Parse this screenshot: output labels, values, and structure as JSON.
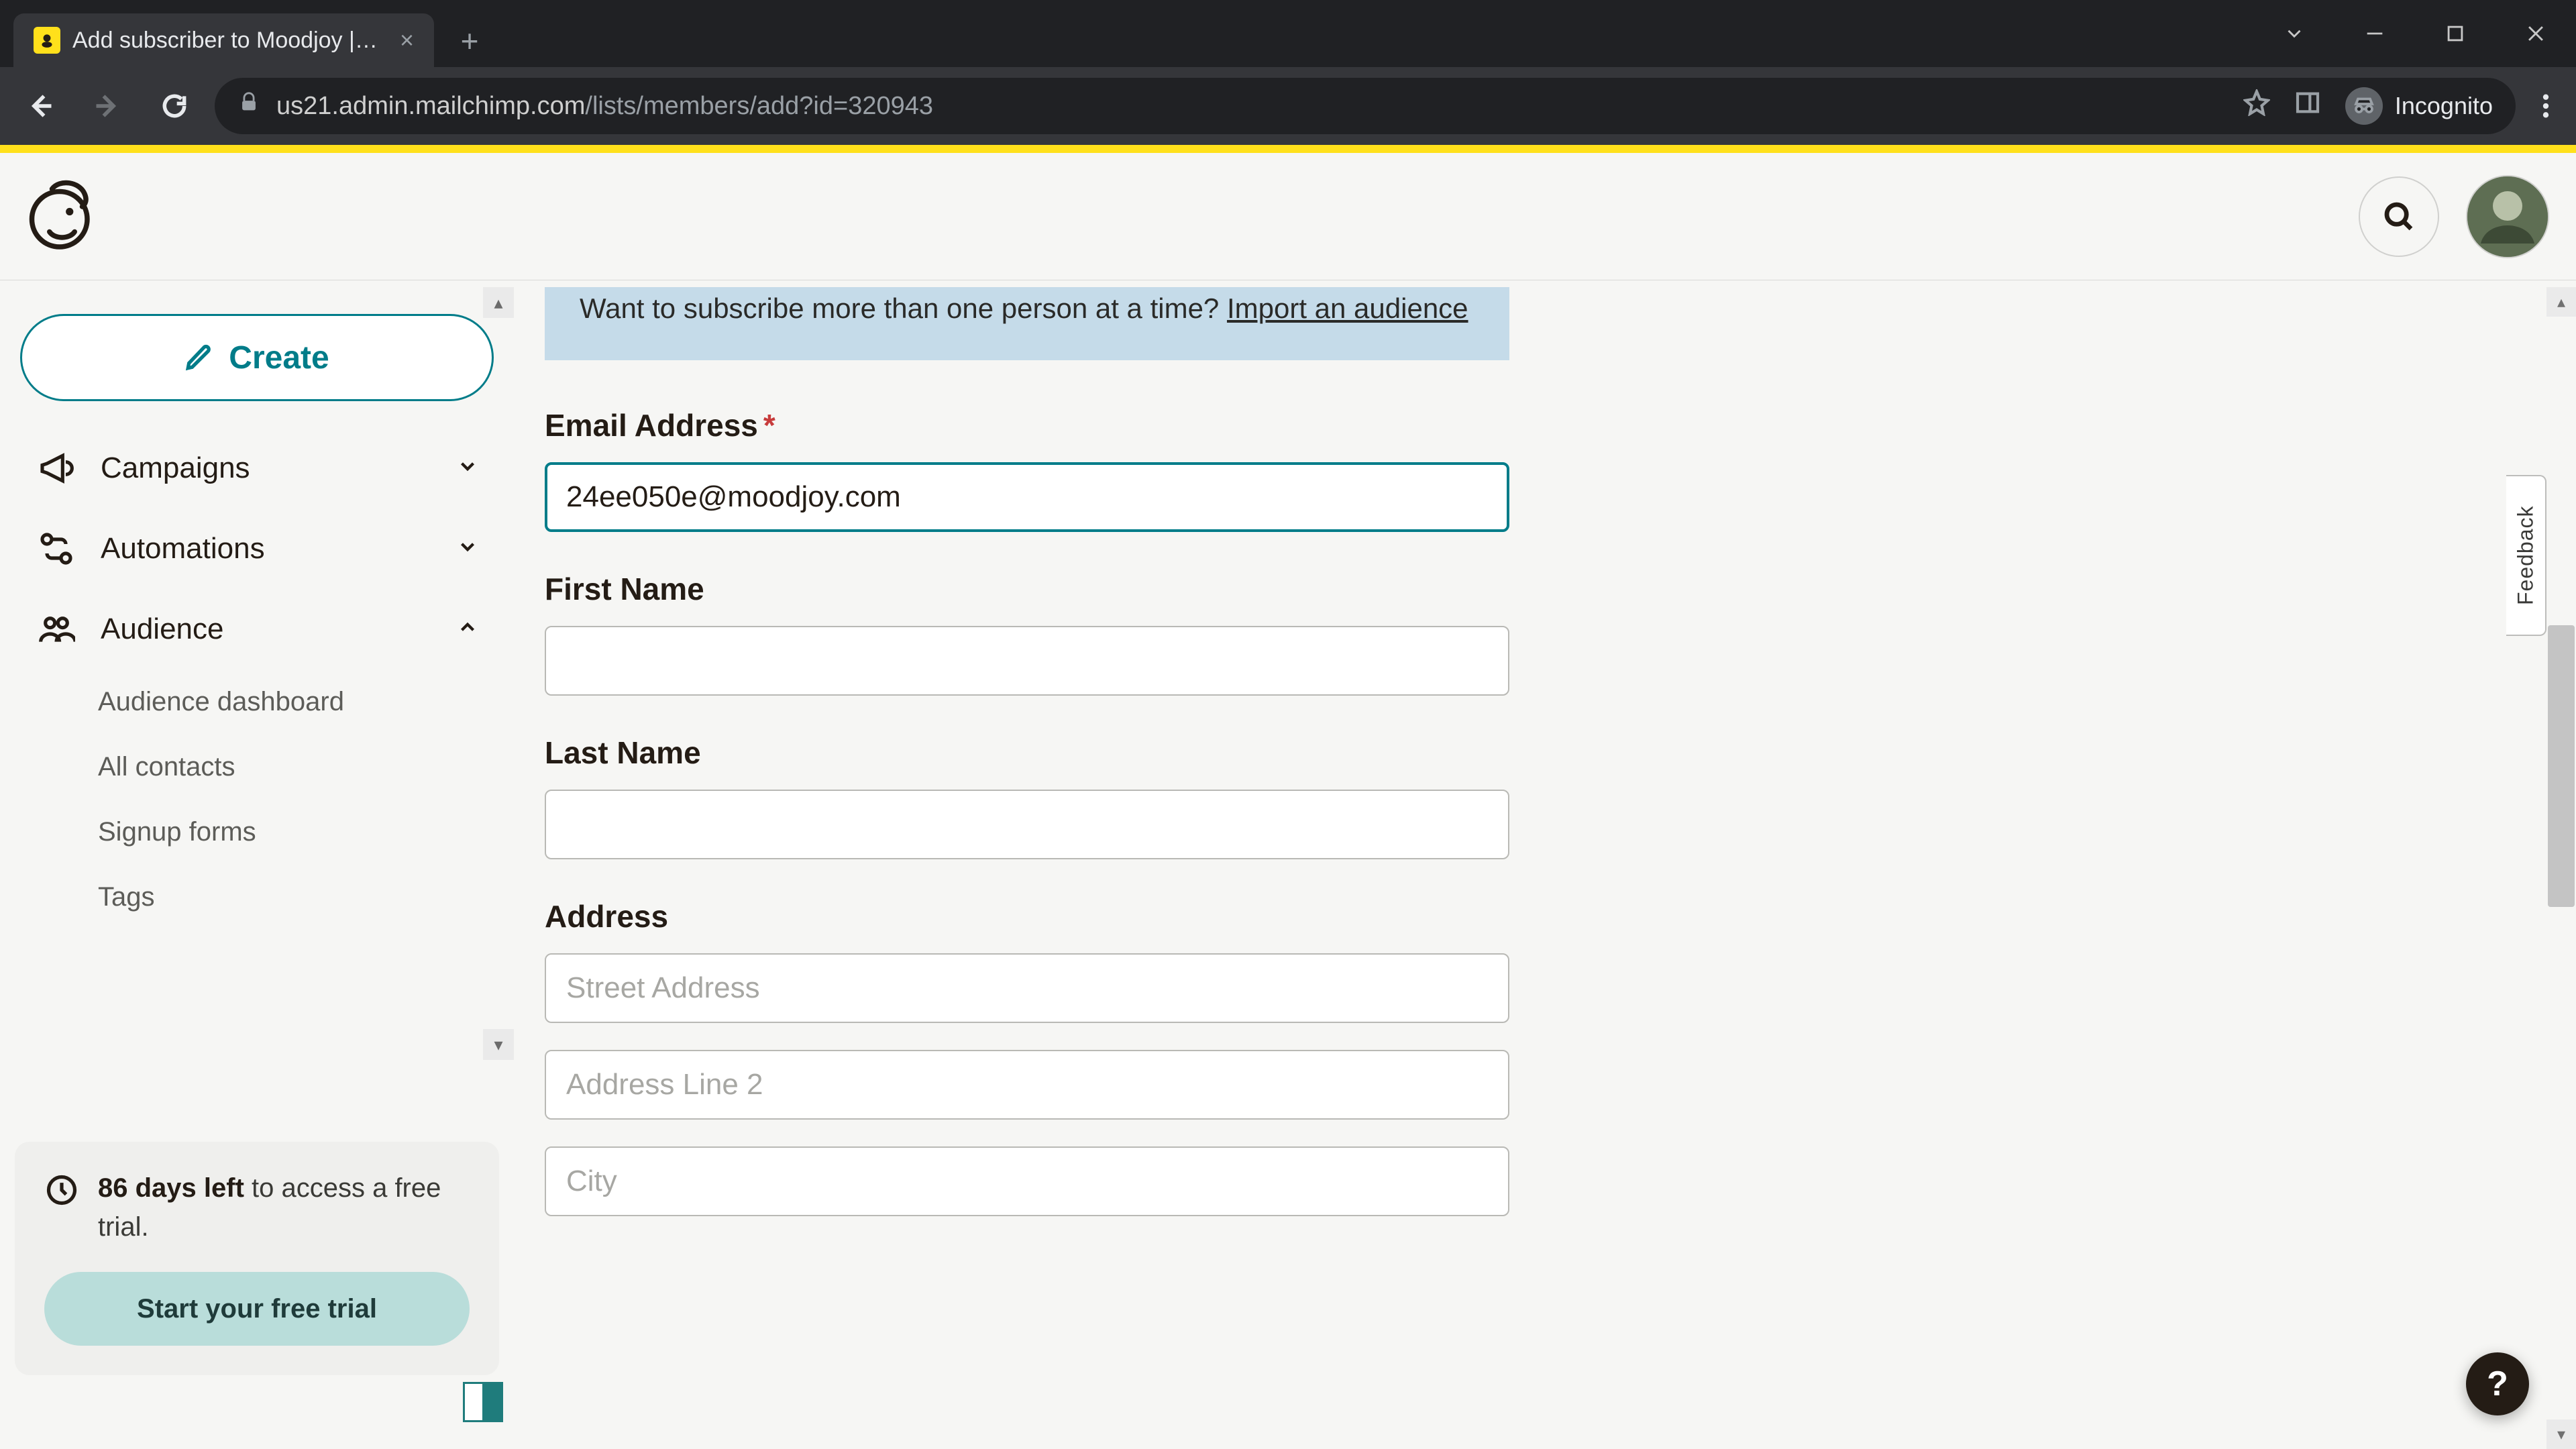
{
  "browser": {
    "tab_title": "Add subscriber to Moodjoy | Ma",
    "url_host": "us21.admin.mailchimp.com",
    "url_path": "/lists/members/add?id=320943",
    "incognito_label": "Incognito"
  },
  "header": {
    "search_aria": "Search"
  },
  "sidebar": {
    "create_label": "Create",
    "items": [
      {
        "label": "Campaigns",
        "expanded": false
      },
      {
        "label": "Automations",
        "expanded": false
      },
      {
        "label": "Audience",
        "expanded": true
      }
    ],
    "audience_sub": [
      "Audience dashboard",
      "All contacts",
      "Signup forms",
      "Tags"
    ],
    "trial": {
      "bold": "86 days left",
      "rest": " to access a free trial.",
      "cta": "Start your free trial"
    }
  },
  "banner": {
    "lead": "Want to subscribe more than one person at a time? ",
    "link": "Import an audience"
  },
  "form": {
    "email_label": "Email Address",
    "email_value": "24ee050e@moodjoy.com",
    "first_name_label": "First Name",
    "first_name_value": "",
    "last_name_label": "Last Name",
    "last_name_value": "",
    "address_label": "Address",
    "street_placeholder": "Street Address",
    "line2_placeholder": "Address Line 2",
    "city_placeholder": "City"
  },
  "feedback_tab": "Feedback",
  "help_fab": "?"
}
